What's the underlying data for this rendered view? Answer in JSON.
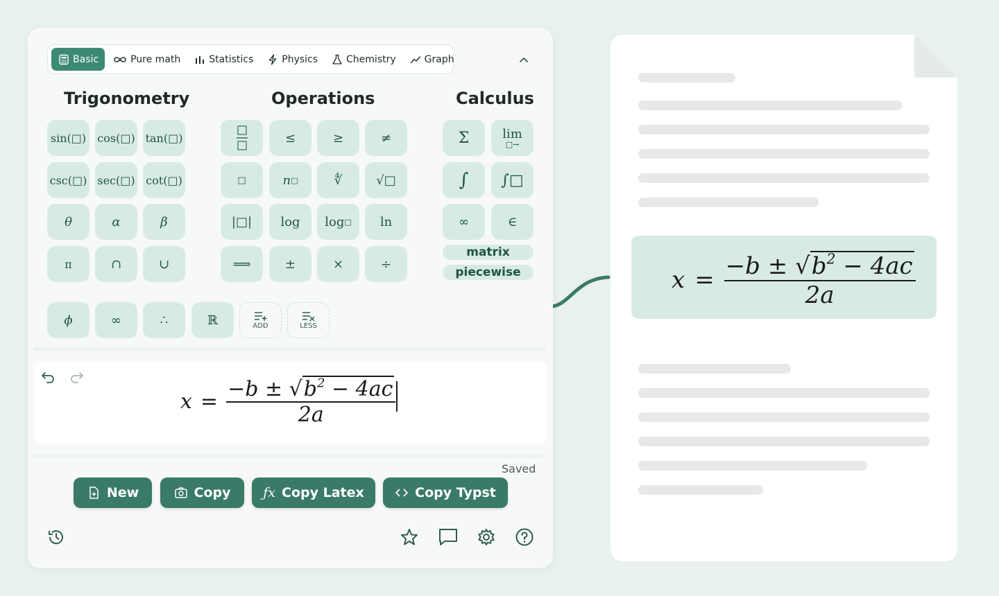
{
  "tabs": [
    {
      "label": "Basic",
      "icon": "calculator-icon",
      "active": true
    },
    {
      "label": "Pure math",
      "icon": "infinity-icon"
    },
    {
      "label": "Statistics",
      "icon": "bar-chart-icon"
    },
    {
      "label": "Physics",
      "icon": "lightning-icon"
    },
    {
      "label": "Chemistry",
      "icon": "flask-icon"
    },
    {
      "label": "Graph",
      "icon": "line-graph-icon"
    }
  ],
  "groups": {
    "trigonometry": "Trigonometry",
    "operations": "Operations",
    "calculus": "Calculus"
  },
  "keys": {
    "trig": [
      "sin(□)",
      "cos(□)",
      "tan(□)",
      "csc(□)",
      "sec(□)",
      "cot(□)",
      "θ",
      "α",
      "β",
      "π",
      "∩",
      "∪"
    ],
    "ops": [
      "□⁄□",
      "≤",
      "≥",
      "≠",
      "□",
      "n□",
      "∜",
      "√□",
      "|□|",
      "log",
      "log□",
      "ln",
      "⟹",
      "±",
      "×",
      "÷"
    ],
    "calc": [
      "Σ",
      "lim",
      "∫",
      "∫□",
      "∞",
      "∈"
    ],
    "extra": [
      "ϕ",
      "∞",
      "∴",
      "ℝ"
    ]
  },
  "pills": {
    "matrix": "matrix",
    "piecewise": "piecewise"
  },
  "mini_labels": {
    "add": "ADD",
    "less": "LESS"
  },
  "formula": {
    "lhs": "x",
    "eq": "=",
    "num_pre": "−b ± ",
    "radicand_b": "b",
    "radicand_exp": "2",
    "radicand_rest": " − 4ac",
    "den": "2a"
  },
  "status": "Saved",
  "buttons": {
    "new": "New",
    "copy": "Copy",
    "copy_latex": "Copy Latex",
    "copy_typst": "Copy Typst"
  },
  "colors": {
    "accent": "#3a7a68",
    "key_bg": "#d7ebe3",
    "background": "#e9f1ec"
  }
}
